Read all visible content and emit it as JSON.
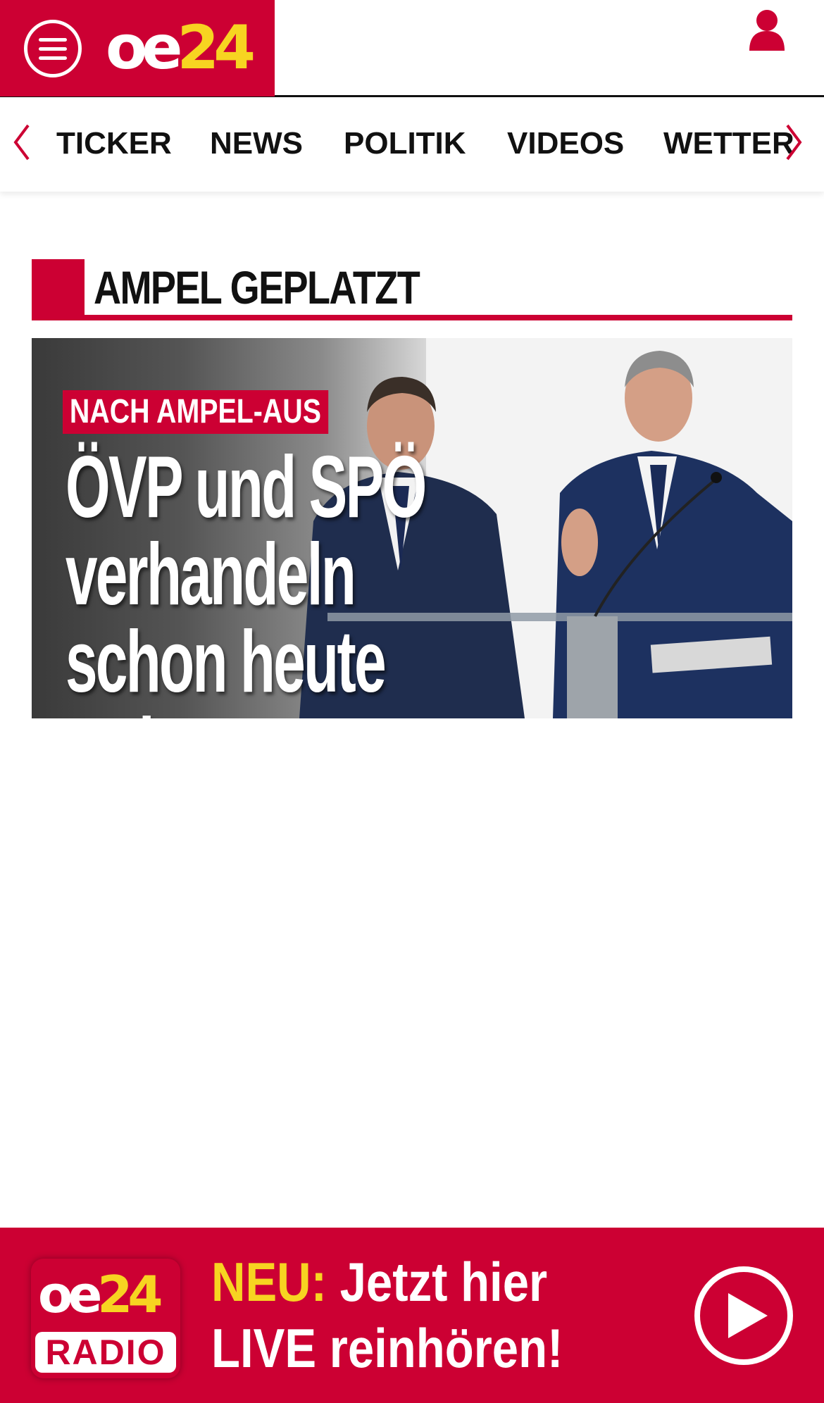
{
  "header": {
    "logo": {
      "oe": "oe",
      "num": "24"
    }
  },
  "nav": {
    "items": [
      "TICKER",
      "NEWS",
      "POLITIK",
      "VIDEOS",
      "WETTER"
    ]
  },
  "section": {
    "title": "AMPEL GEPLATZT"
  },
  "hero": {
    "kicker": "NACH AMPEL-AUS",
    "headline_lines": [
      "ÖVP und SPÖ",
      "verhandeln",
      "schon heute weiter"
    ]
  },
  "radio_banner": {
    "logo_oe": "oe",
    "logo_num": "24",
    "logo_radio": "RADIO",
    "neu": "NEU:",
    "line1_rest": " Jetzt hier",
    "line2": "LIVE reinhören!"
  },
  "colors": {
    "brand_red": "#cc0033",
    "brand_yellow": "#f7d421"
  }
}
